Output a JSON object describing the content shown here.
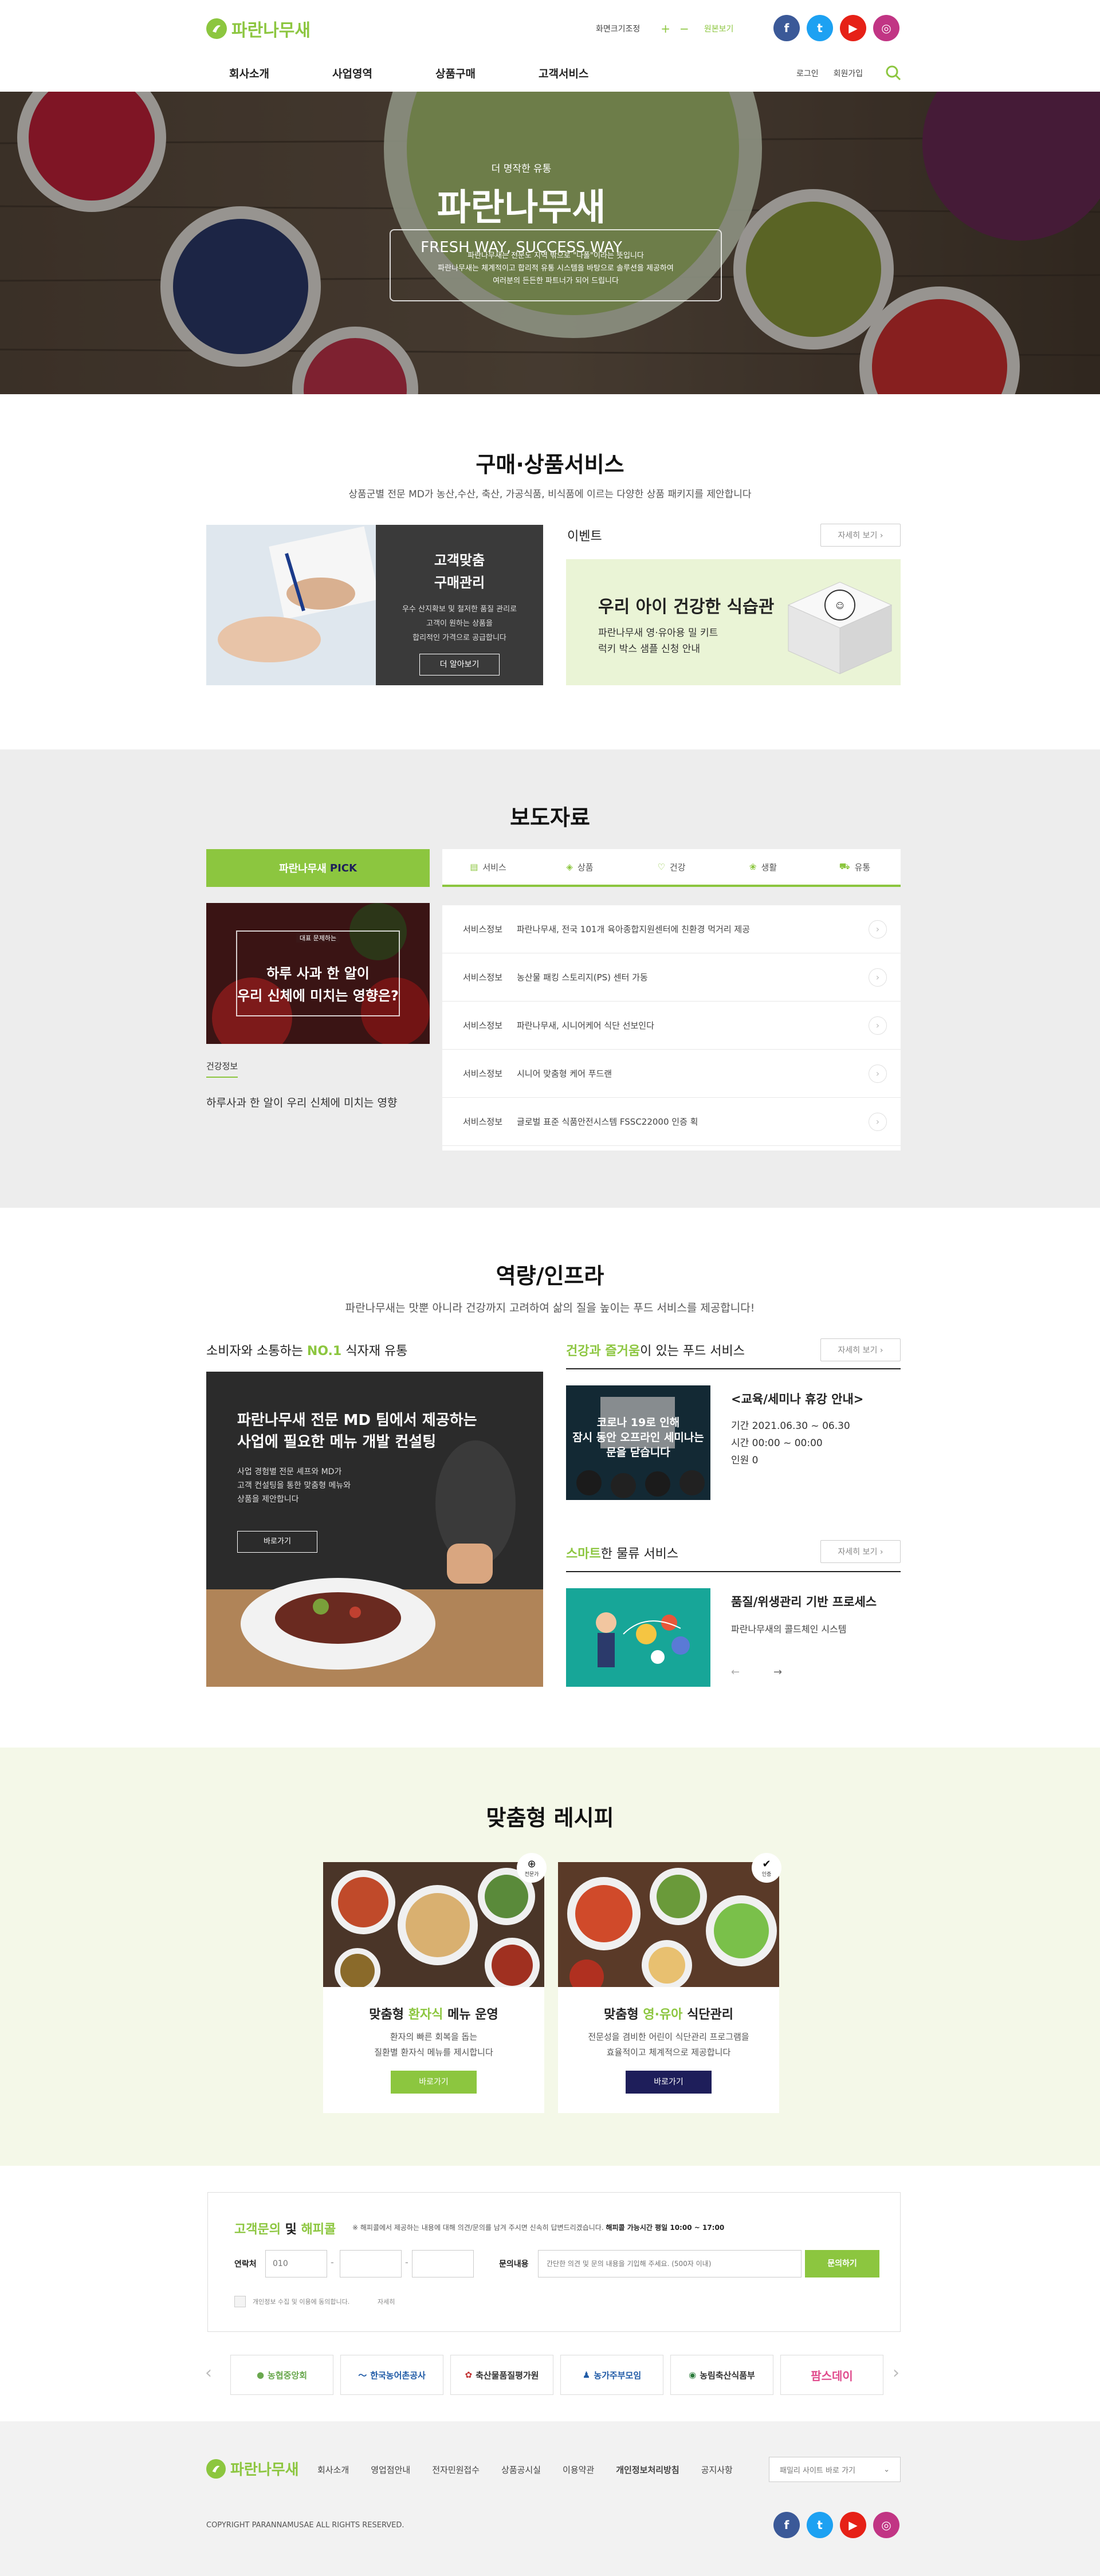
{
  "header": {
    "logo_text": "파란나무새",
    "font_size_label": "화면크기조정",
    "zoom_plus": "+",
    "zoom_minus": "−",
    "zoom_reset": "원본보기",
    "nav": [
      "회사소개",
      "사업영역",
      "상품구매",
      "고객서비스"
    ],
    "login": "로그인",
    "join": "회원가입",
    "social": [
      "facebook-icon",
      "twitter-icon",
      "youtube-icon",
      "instagram-icon"
    ]
  },
  "hero": {
    "eyebrow": "더 명작한 유통",
    "title": "파란나무새",
    "slogan": "FRESH WAY, SUCCESS WAY",
    "desc_1": "파란나무새는 전문도 지역 밖으로 \"나폴\"이라는 뜻입니다",
    "desc_2": "파란나무새는 체계적이고 합리적 유통 시스템을 바탕으로 솔루션을 제공하여",
    "desc_3": "여러분의 든든한 파트너가 되어 드립니다"
  },
  "purchase": {
    "title": "구매·상품서비스",
    "subtitle": "상품군별 전문 MD가 농산,수산, 축산, 가공식품, 비식품에 이르는 다양한 상품 패키지를 제안합니다",
    "card_title_1": "고객맞춤",
    "card_title_2": "구매관리",
    "card_desc_1": "우수 산지확보 및 철저한 품질 관리로",
    "card_desc_2": "고객이 원하는 상품을",
    "card_desc_3": "합리적인 가격으로 공급합니다",
    "card_button": "더 알아보기",
    "event_label": "이벤트",
    "more_label": "자세히 보기 ›",
    "event_title": "우리 아이 건강한 식습관",
    "event_desc_1": "파란나무새 영·유아용 밀 키트",
    "event_desc_2": "럭키 박스 샘플 신청 안내"
  },
  "press": {
    "title": "보도자료",
    "pick_label_1": "파란나무새",
    "pick_label_2": "PICK",
    "pick_image_eyebrow": "대표 문제하는",
    "pick_image_line_1": "하루 사과 한 알이",
    "pick_image_line_2": "우리 신체에 미치는 영향은?",
    "pick_category": "건강정보",
    "pick_caption": "하루사과 한 알이 우리 신체에 미치는 영향",
    "tabs": [
      "서비스",
      "상품",
      "건강",
      "생활",
      "유통"
    ],
    "rows": [
      {
        "category": "서비스정보",
        "title": "파란나무새, 전국 101개 육아종합지원센터에 친환경 먹거리 제공"
      },
      {
        "category": "서비스정보",
        "title": "농산물 패킹 스토리지(PS) 센터 가동"
      },
      {
        "category": "서비스정보",
        "title": "파란나무새, 시니어케어 식단 선보인다"
      },
      {
        "category": "서비스정보",
        "title": "시니어 맞춤형 케어 푸드랜"
      },
      {
        "category": "서비스정보",
        "title": "글로벌 표준 식품안전시스템 FSSC22000 인증 획"
      }
    ]
  },
  "capacity": {
    "title": "역량/인프라",
    "subtitle": "파란나무새는 맛뿐 아니라 건강까지 고려하여 삶의 질을 높이는 푸드 서비스를 제공합니다!",
    "left_heading_pre": "소비자와 소통하는 ",
    "left_heading_em": "NO.1",
    "left_heading_post": " 식자재 유통",
    "feature_title_1": "파란나무새 전문 MD 팀에서 제공하는",
    "feature_title_2": "사업에 필요한 메뉴 개발 컨설팅",
    "feature_desc_1": "사업 경험별 전문 셰프와 MD가",
    "feature_desc_2": "고객 컨설팅을 통한 맞춤형 메뉴와",
    "feature_desc_3": "상품을 제안합니다",
    "feature_button": "바로가기",
    "food_heading_em": "건강과 즐거움",
    "food_heading_post": "이 있는 푸드 서비스",
    "more_label": "자세히 보기 ›",
    "food_image_line_1": "코로나 19로 인해",
    "food_image_line_2": "잠시 동안 오프라인 세미나는",
    "food_image_line_3": "문을 닫습니다",
    "food_title": "<교육/세미나 휴강 안내>",
    "food_period": "기간 2021.06.30 ~ 06.30",
    "food_time": "시간 00:00 ~ 00:00",
    "food_people": "인원 0",
    "smart_heading_em": "스마트",
    "smart_heading_post": "한 물류 서비스",
    "smart_title": "품질/위생관리 기반 프로세스",
    "smart_desc": "파란나무새의 콜드체인 시스템",
    "prev": "←",
    "next": "→"
  },
  "recipe": {
    "title": "맞춤형 레시피",
    "cards": [
      {
        "badge": "전문가",
        "title_pre": "맞춤형 ",
        "title_em": "환자식",
        "title_post": " 메뉴 운영",
        "desc_1": "환자의 빠른 회복을 돕는",
        "desc_2": "질환별 환자식 메뉴를 제시합니다",
        "button": "바로가기",
        "button_color": "#8cc63f"
      },
      {
        "badge": "인증",
        "title_pre": "맞춤형 ",
        "title_em": "영·유아",
        "title_post": " 식단관리",
        "desc_1": "전문성을 겸비한 어린이 식단관리 프로그램을",
        "desc_2": "효율적이고 체계적으로 제공합니다",
        "button": "바로가기",
        "button_color": "#1e1e5a"
      }
    ]
  },
  "inquiry": {
    "title_pre": "고객문의 ",
    "title_mid": "및 ",
    "title_em": "해피콜",
    "notice_pre": "※ 해피콜에서 제공하는 내용에 대해 의견/문의를 남겨 주시면 신속히 답변드리겠습니다. ",
    "notice_bold": "해피콜 가능시간 평일 10:00 ~ 17:00",
    "contact_label": "연락처",
    "phone_placeholder": "010",
    "dash": "-",
    "inquiry_label": "문의내용",
    "inquiry_placeholder": "간단한 의견 및 문의 내용을 기입해 주세요. (500자 이내)",
    "submit": "문의하기",
    "agree_label": "개인정보 수집 및 이용에 동의합니다.",
    "agree_link": "자세히"
  },
  "partners": {
    "prev": "‹",
    "next": "›",
    "items": [
      {
        "name": "농협중앙회",
        "color": "#6aa84f"
      },
      {
        "name": "한국농어촌공사",
        "color": "#1f5aa6"
      },
      {
        "name": "축산물품질평가원",
        "color": "#333333"
      },
      {
        "name": "농가주부모임",
        "color": "#1f5aa6"
      },
      {
        "name": "농림축산식품부",
        "color": "#333333"
      },
      {
        "name": "팜스데이",
        "color": "#e04a8c"
      }
    ]
  },
  "footer": {
    "logo_text": "파란나무새",
    "links": [
      "회사소개",
      "영업점안내",
      "전자민원접수",
      "상품공시실",
      "이용약관",
      "개인정보처리방침",
      "공지사항"
    ],
    "family_site": "패밀리 사이트 바로 가기",
    "copyright": "COPYRIGHT PARANNAMUSAE ALL RIGHTS RESERVED."
  },
  "colors": {
    "accent": "#8cc63f",
    "navy": "#1e1e5a",
    "gray_bg": "#ededed",
    "light_green_bg": "#f4f8e8",
    "facebook": "#3b5998",
    "twitter": "#1da1f2",
    "youtube": "#e62117",
    "instagram": "#c13584"
  }
}
